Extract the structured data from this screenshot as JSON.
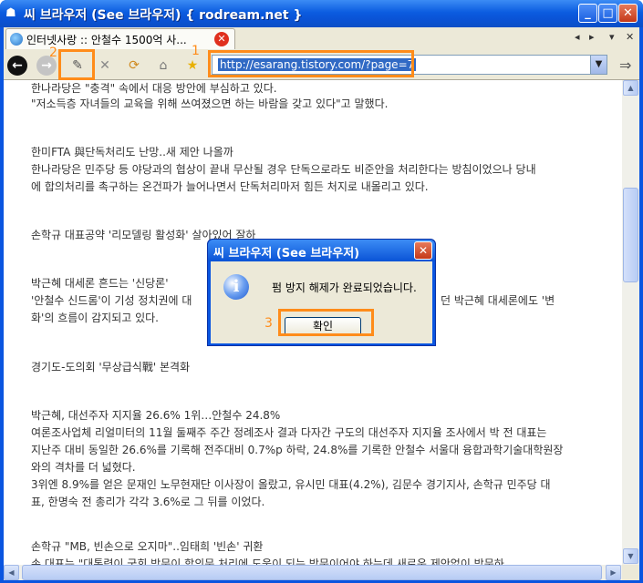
{
  "window": {
    "title": "씨 브라우저 (See 브라우저) { rodream.net }",
    "minimize": "_",
    "maximize": "□",
    "close": "✕"
  },
  "tabs": [
    {
      "title": "인터넷사랑 :: 안철수 1500억 사...",
      "close": "✕"
    }
  ],
  "tab_nav": {
    "prev": "◂",
    "next": "▸",
    "menu": "▾",
    "close": "✕"
  },
  "toolbar": {
    "back_icon": "back-arrow-icon",
    "forward_icon": "forward-arrow-icon",
    "address": "http://esarang.tistory.com/?page=7",
    "go": "⇒"
  },
  "annotations": {
    "one": "1",
    "two": "2",
    "three": "3"
  },
  "content": [
    "한나라당은 \"충격\" 속에서 대응 방안에 부심하고 있다.",
    "\"저소득층 자녀들의 교육을 위해 쓰여졌으면 하는 바람을 갖고 있다\"고 말했다.",
    "한미FTA 與단독처리도 난망..새 제안 나올까",
    "한나라당은 민주당 등 야당과의 협상이 끝내 무산될 경우 단독으로라도 비준안을 처리한다는 방침이었으나 당내",
    "에 합의처리를 촉구하는 온건파가 늘어나면서 단독처리마저 힘든 처지로 내몰리고 있다.",
    "손학규 대표공약 '리모델링 활성화' 살아있어 잘하",
    "박근혜 대세론 흔드는 '신당론'",
    "'안철수 신드롬'이 기성 정치권에 대",
    "던 박근혜 대세론에도 '변",
    "화'의 흐름이 감지되고 있다.",
    "경기도-도의회 '무상급식戰' 본격화",
    "박근혜, 대선주자 지지율 26.6% 1위…안철수 24.8%",
    "여론조사업체 리얼미터의 11월 둘째주 주간 정례조사 결과 다자간 구도의 대선주자 지지율 조사에서 박 전 대표는",
    "지난주 대비 동일한 26.6%를 기록해 전주대비 0.7%p 하락, 24.8%를 기록한 안철수 서울대 융합과학기술대학원장",
    "와의 격차를 더 넓혔다.",
    "3위엔 8.9%를 얻은 문재인 노무현재단 이사장이 올랐고, 유시민 대표(4.2%), 김문수 경기지사, 손학규 민주당 대",
    "표, 한명숙 전 총리가 각각 3.6%로 그 뒤를 이었다.",
    "손학규 \"MB, 빈손으로 오지마\"..임태희 '빈손' 귀환",
    "손 대표는 \"대통령이 국회 방문이 합의문 처리에 도움이 되는 방문이어야 하는데 새로운 제안없이 방문하"
  ],
  "dialog": {
    "title": "씨 브라우저 (See 브라우저)",
    "close": "✕",
    "message": "펌 방지 해제가 완료되었습니다.",
    "ok_label": "확인",
    "icon": "i"
  },
  "colors": {
    "highlight": "#ff8c1a",
    "titlebar": "#0a55e0"
  }
}
